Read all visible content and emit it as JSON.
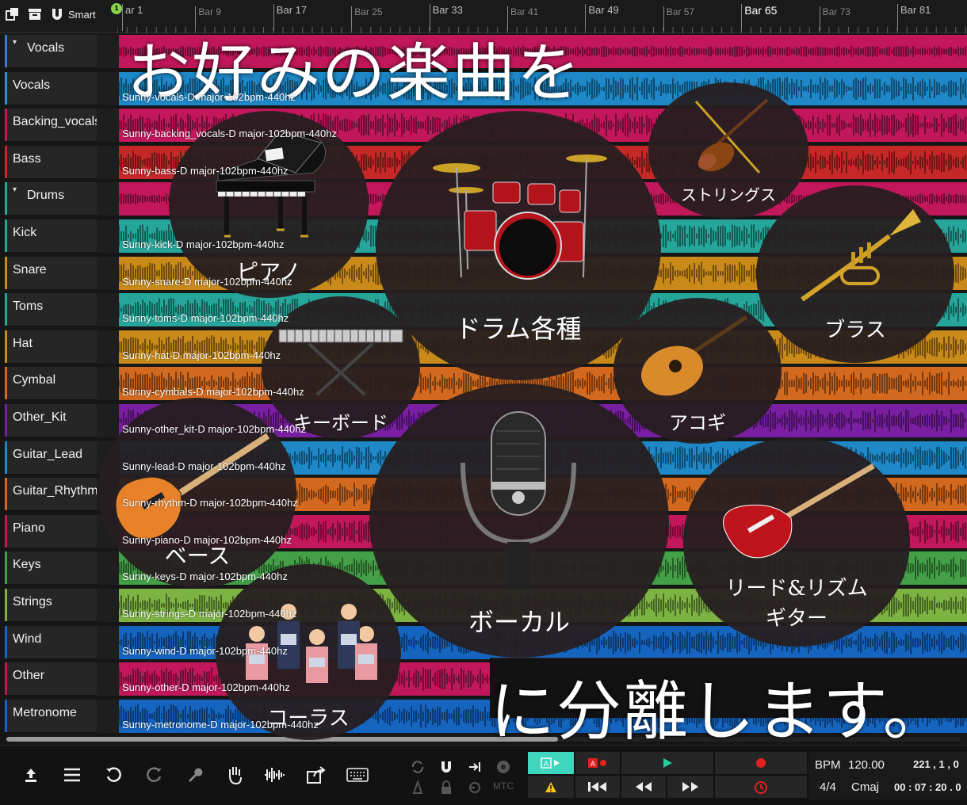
{
  "toolbar_top": {
    "smart_label": "Smart",
    "playhead_badge": "1",
    "first_bar_label": "ar 1"
  },
  "ruler": {
    "bars": [
      {
        "label": "Bar 9",
        "style": "minor"
      },
      {
        "label": "Bar 17",
        "style": "major"
      },
      {
        "label": "Bar 25",
        "style": "minor"
      },
      {
        "label": "Bar 33",
        "style": "major"
      },
      {
        "label": "Bar 41",
        "style": "minor"
      },
      {
        "label": "Bar 49",
        "style": "major"
      },
      {
        "label": "Bar 57",
        "style": "minor"
      },
      {
        "label": "Bar 65",
        "style": "bright"
      },
      {
        "label": "Bar 73",
        "style": "minor"
      },
      {
        "label": "Bar 81",
        "style": "major"
      }
    ]
  },
  "tracks": [
    {
      "name": "Vocals",
      "folder": true,
      "accent": "#3a7bd5",
      "color": "#c2185b",
      "clip": ""
    },
    {
      "name": "Vocals",
      "folder": false,
      "accent": "#2f8fd0",
      "color": "#1e88c8",
      "clip": "Sunny-vocals-D major-102bpm-440hz"
    },
    {
      "name": "Backing_vocals",
      "folder": false,
      "accent": "#c2185b",
      "color": "#c2185b",
      "clip": "Sunny-backing_vocals-D major-102bpm-440hz"
    },
    {
      "name": "Bass",
      "folder": false,
      "accent": "#c62828",
      "color": "#c62828",
      "clip": "Sunny-bass-D major-102bpm-440hz"
    },
    {
      "name": "Drums",
      "folder": true,
      "accent": "#26a69a",
      "color": "#c2185b",
      "clip": ""
    },
    {
      "name": "Kick",
      "folder": false,
      "accent": "#26a69a",
      "color": "#26a69a",
      "clip": "Sunny-kick-D major-102bpm-440hz"
    },
    {
      "name": "Snare",
      "folder": false,
      "accent": "#c98a1a",
      "color": "#c98a1a",
      "clip": "Sunny-snare-D major-102bpm-440hz"
    },
    {
      "name": "Toms",
      "folder": false,
      "accent": "#26a69a",
      "color": "#26a69a",
      "clip": "Sunny-toms-D major-102bpm-440hz"
    },
    {
      "name": "Hat",
      "folder": false,
      "accent": "#c98a1a",
      "color": "#c98a1a",
      "clip": "Sunny-hat-D major-102bpm-440hz"
    },
    {
      "name": "Cymbal",
      "folder": false,
      "accent": "#d2691e",
      "color": "#d2691e",
      "clip": "Sunny-cymbals-D major-102bpm-440hz"
    },
    {
      "name": "Other_Kit",
      "folder": false,
      "accent": "#7b1fa2",
      "color": "#7b1fa2",
      "clip": "Sunny-other_kit-D major-102bpm-440hz"
    },
    {
      "name": "Guitar_Lead",
      "folder": false,
      "accent": "#1e88c8",
      "color": "#1e88c8",
      "clip": "Sunny-lead-D major-102bpm-440hz"
    },
    {
      "name": "Guitar_Rhythm",
      "folder": false,
      "accent": "#d2691e",
      "color": "#d2691e",
      "clip": "Sunny-rhythm-D major-102bpm-440hz"
    },
    {
      "name": "Piano",
      "folder": false,
      "accent": "#c2185b",
      "color": "#c2185b",
      "clip": "Sunny-piano-D major-102bpm-440hz"
    },
    {
      "name": "Keys",
      "folder": false,
      "accent": "#43a047",
      "color": "#43a047",
      "clip": "Sunny-keys-D major-102bpm-440hz"
    },
    {
      "name": "Strings",
      "folder": false,
      "accent": "#7cb342",
      "color": "#7cb342",
      "clip": "Sunny-strings-D major-102bpm-440hz"
    },
    {
      "name": "Wind",
      "folder": false,
      "accent": "#1565c0",
      "color": "#1565c0",
      "clip": "Sunny-wind-D major-102bpm-440hz"
    },
    {
      "name": "Other",
      "folder": false,
      "accent": "#c2185b",
      "color": "#c2185b",
      "clip": "Sunny-other-D major-102bpm-440hz"
    },
    {
      "name": "Metronome",
      "folder": false,
      "accent": "#1565c0",
      "color": "#1565c0",
      "clip": "Sunny-metronome-D major-102bpm-440hz"
    }
  ],
  "overlay": {
    "headline_top": "お好みの楽曲を",
    "headline_bottom": "に分離します。",
    "circles": {
      "piano": "ピアノ",
      "drums": "ドラム各種",
      "strings": "ストリングス",
      "brass": "ブラス",
      "keyboard": "キーボード",
      "acoustic": "アコギ",
      "bass": "ベース",
      "vocal": "ボーカル",
      "guitar_line1": "リード&リズム",
      "guitar_line2": "ギター",
      "chorus": "コーラス"
    }
  },
  "transport": {
    "mtc_label": "MTC",
    "bpm_label": "BPM",
    "bpm_value": "120.00",
    "position_bars": "221 ,  1 ,  0",
    "time_signature": "4/4",
    "key": "Cmaj",
    "timecode": "00 : 07 : 20 . 0"
  },
  "colors": {
    "accent_green": "#3fd6c0",
    "record_red": "#e0211d",
    "play_green": "#22d3a0",
    "warning_yellow": "#f5c518"
  }
}
